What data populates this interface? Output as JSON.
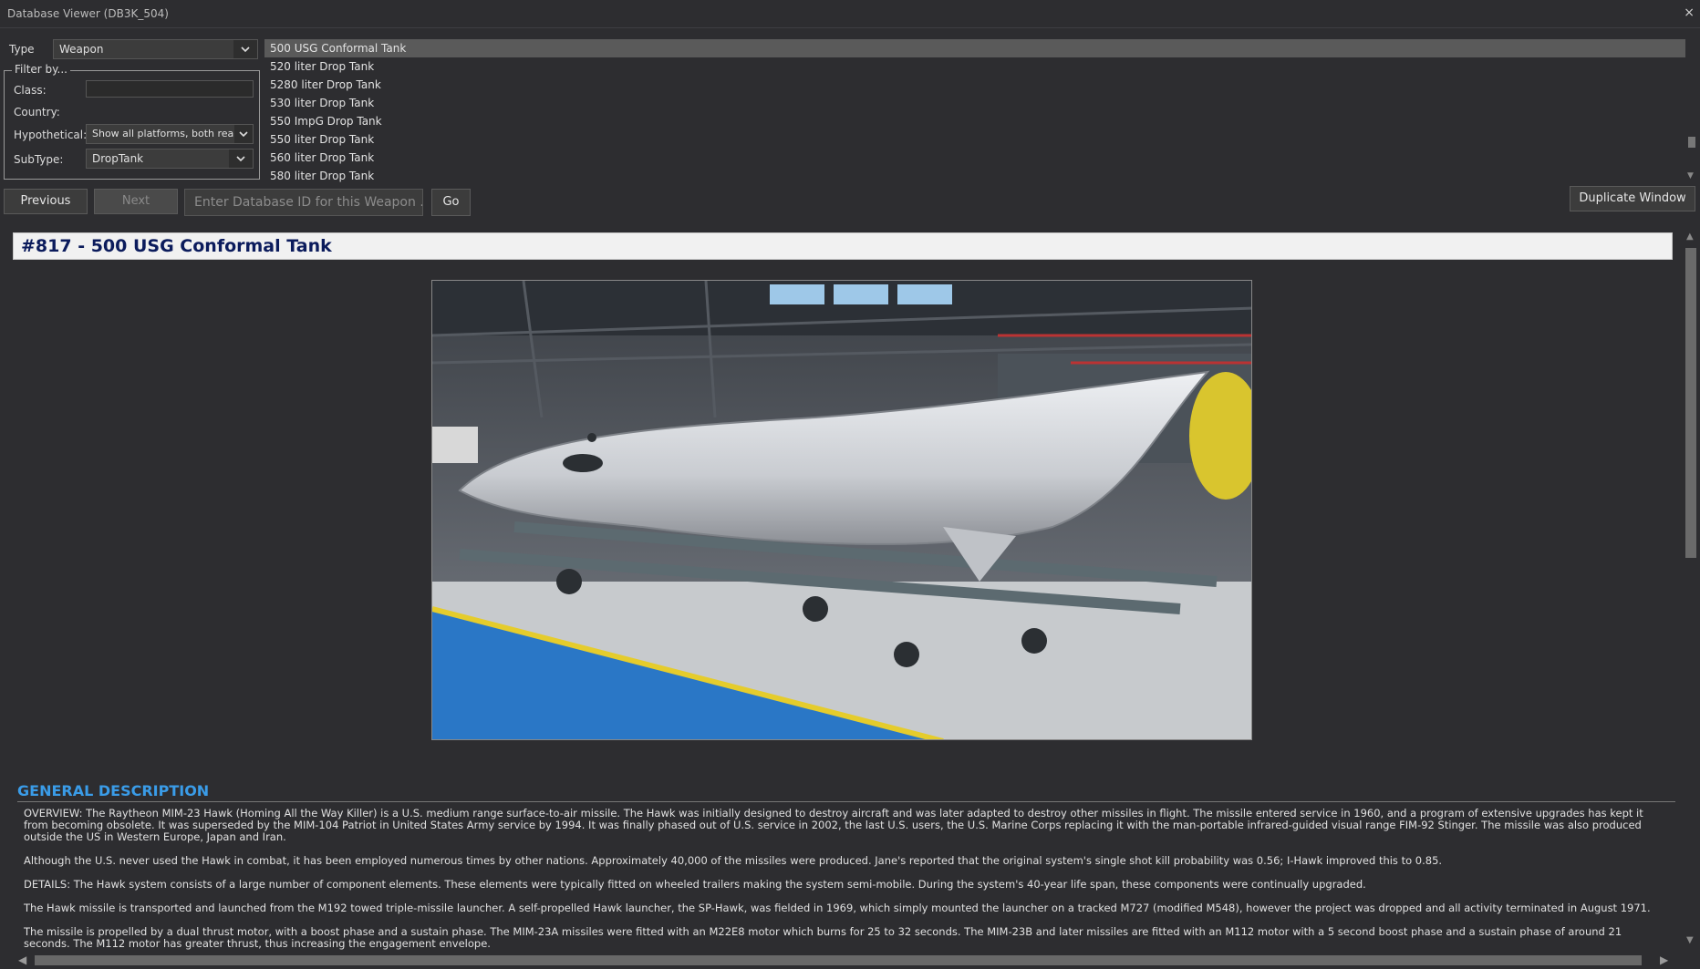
{
  "window": {
    "title": "Database Viewer (DB3K_504)",
    "close_glyph": "×"
  },
  "type_field": {
    "label": "Type",
    "value": "Weapon"
  },
  "filter": {
    "legend": "Filter by...",
    "class_label": "Class:",
    "class_value": "",
    "country_label": "Country:",
    "hypothetical_label": "Hypothetical:",
    "hypothetical_value": "Show all platforms, both real",
    "subtype_label": "SubType:",
    "subtype_value": "DropTank"
  },
  "list": {
    "items": [
      "500 USG Conformal Tank",
      "520 liter Drop Tank",
      "5280 liter Drop Tank",
      "530 liter Drop Tank",
      "550 ImpG Drop Tank",
      "550 liter Drop Tank",
      "560 liter Drop Tank",
      "580 liter Drop Tank"
    ],
    "selected_index": 0
  },
  "nav": {
    "previous_label": "Previous",
    "next_label": "Next",
    "db_id_placeholder": "Enter Database ID for this Weapon ...",
    "go_label": "Go",
    "duplicate_label": "Duplicate Window"
  },
  "record": {
    "heading": "#817 - 500 USG Conformal Tank",
    "section_title": "GENERAL DESCRIPTION",
    "paragraphs": [
      "OVERVIEW: The Raytheon MIM-23 Hawk (Homing All the Way Killer) is a U.S. medium range surface-to-air missile. The Hawk was initially designed to destroy aircraft and was later adapted to destroy other missiles in flight. The missile entered service in 1960, and a program of extensive upgrades has kept it from becoming obsolete. It was superseded by the MIM-104 Patriot in United States Army service by 1994. It was finally phased out of U.S. service in 2002, the last U.S. users, the U.S. Marine Corps replacing it with the man-portable infrared-guided visual range FIM-92 Stinger. The missile was also produced outside the US in Western Europe, Japan and Iran.",
      "Although the U.S. never used the Hawk in combat, it has been employed numerous times by other nations. Approximately 40,000 of the missiles were produced. Jane's reported that the original system's single shot kill probability was 0.56; I-Hawk improved this to 0.85.",
      "DETAILS: The Hawk system consists of a large number of component elements. These elements were typically fitted on wheeled trailers making the system semi-mobile. During the system's 40-year life span, these components were continually upgraded.",
      "The Hawk missile is transported and launched from the M192 towed triple-missile launcher. A self-propelled Hawk launcher, the SP-Hawk, was fielded in 1969, which simply mounted the launcher on a tracked M727 (modified M548), however the project was dropped and all activity terminated in August 1971.",
      "The missile is propelled by a dual thrust motor, with a boost phase and a sustain phase. The MIM-23A missiles were fitted with an M22E8 motor which burns for 25 to 32 seconds. The MIM-23B and later missiles are fitted with an M112 motor with a 5 second boost phase and a sustain phase of around 21 seconds. The M112 motor has greater thrust, thus increasing the engagement envelope."
    ]
  },
  "colors": {
    "background": "#2d2d30",
    "heading_text": "#0b1b5c",
    "section_title": "#3a9ce8",
    "selection": "#5a5a5a"
  },
  "icons": [
    "chevron-down-icon",
    "close-icon",
    "scroll-arrow-icon"
  ]
}
